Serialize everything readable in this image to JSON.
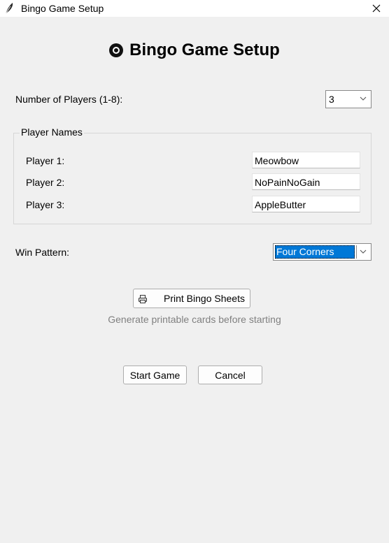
{
  "window": {
    "title": "Bingo Game Setup",
    "icon": "feather-icon"
  },
  "heading": {
    "text": "Bingo Game Setup",
    "icon": "bingo-ball-icon"
  },
  "players_count": {
    "label": "Number of Players (1-8):",
    "value": "3"
  },
  "player_names": {
    "legend": "Player Names",
    "players": [
      {
        "label": "Player 1:",
        "name": "Meowbow"
      },
      {
        "label": "Player 2:",
        "name": "NoPainNoGain"
      },
      {
        "label": "Player 3:",
        "name": "AppleButter"
      }
    ]
  },
  "win_pattern": {
    "label": "Win Pattern:",
    "value": "Four Corners"
  },
  "print": {
    "button_label": "Print Bingo Sheets",
    "icon": "printer-icon",
    "hint": "Generate printable cards before starting"
  },
  "actions": {
    "start_label": "Start Game",
    "cancel_label": "Cancel"
  },
  "colors": {
    "window_bg": "#f0f0f0",
    "selection": "#0078d7",
    "hint_text": "#808080"
  }
}
